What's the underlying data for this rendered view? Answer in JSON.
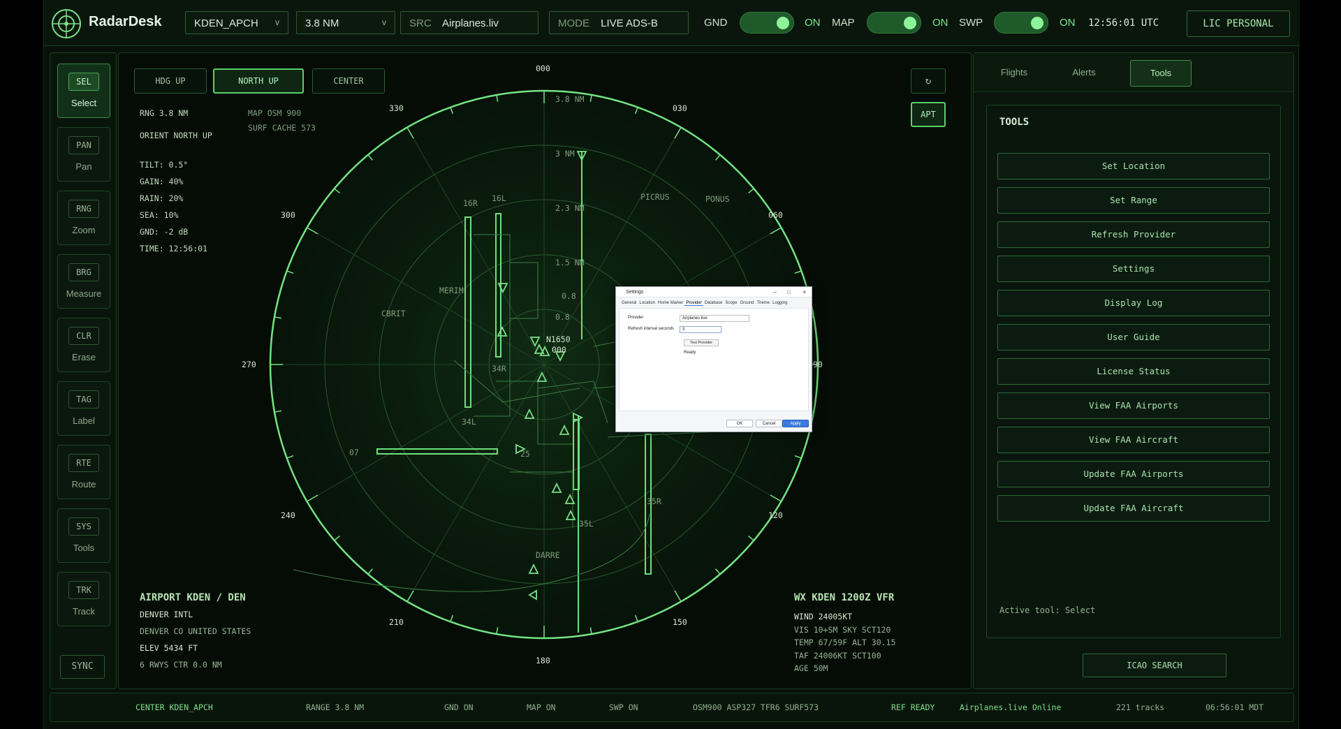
{
  "app": {
    "name": "RadarDesk"
  },
  "topbar": {
    "airport_select": "KDEN_APCH",
    "range_select": "3.8 NM",
    "src_label": "SRC",
    "src_value": "Airplanes.liv",
    "mode_label": "MODE",
    "mode_value": "LIVE ADS-B",
    "toggles": [
      {
        "label": "GND",
        "state": "ON"
      },
      {
        "label": "MAP",
        "state": "ON"
      },
      {
        "label": "SWP",
        "state": "ON"
      }
    ],
    "clock": "12:56:01 UTC",
    "license": "LIC PERSONAL"
  },
  "tools": [
    {
      "code": "SEL",
      "name": "Select",
      "active": true
    },
    {
      "code": "PAN",
      "name": "Pan"
    },
    {
      "code": "RNG",
      "name": "Zoom"
    },
    {
      "code": "BRG",
      "name": "Measure"
    },
    {
      "code": "CLR",
      "name": "Erase"
    },
    {
      "code": "TAG",
      "name": "Label"
    },
    {
      "code": "RTE",
      "name": "Route"
    },
    {
      "code": "SYS",
      "name": "Tools"
    },
    {
      "code": "TRK",
      "name": "Track"
    }
  ],
  "sync_label": "SYNC",
  "radar": {
    "orient_buttons": [
      "HDG UP",
      "NORTH UP",
      "CENTER"
    ],
    "selected_orient": "NORTH UP",
    "refresh_icon": "refresh-icon",
    "apt_button": "APT",
    "rng_text": "RNG  3.8 NM",
    "orient_text": "ORIENT NORTH UP",
    "map_text": "MAP OSM 900",
    "surf_text": "SURF CACHE 573",
    "params": [
      "TILT: 0.5°",
      "GAIN: 40%",
      "RAIN: 20%",
      "SEA: 10%",
      "GND: -2 dB",
      "TIME: 12:56:01"
    ],
    "bearings": [
      "000",
      "030",
      "060",
      "090",
      "120",
      "150",
      "180",
      "210",
      "240",
      "270",
      "300",
      "330"
    ],
    "range_labels": [
      "3.8 NM",
      "3 NM",
      "2.3 NM",
      "1.5 NM",
      "0.8",
      "0.8"
    ],
    "map_labels": [
      "16R",
      "16L",
      "PICRUS",
      "PONUS",
      "MERIM",
      "CBRIT",
      "34R",
      "34L",
      "07",
      "25",
      "35R",
      "35L",
      "DARRE",
      "N1650",
      "000"
    ],
    "airport": {
      "title": "AIRPORT KDEN / DEN",
      "name": "DENVER INTL",
      "location": "DENVER CO UNITED STATES",
      "elev": "ELEV 5434 FT",
      "rwys": "6 RWYS  CTR 0.0 NM"
    },
    "wx": {
      "title": "WX KDEN 1200Z VFR",
      "wind": "WIND 24005KT",
      "vis": "VIS 10+SM  SKY SCT120",
      "temp": "TEMP 67/59F  ALT 30.15",
      "taf": "TAF 24006KT SCT100",
      "age": "AGE 50M"
    }
  },
  "dialog": {
    "title": "Settings",
    "tabs": [
      "General",
      "Location",
      "Home Marker",
      "Provider",
      "Database",
      "Scope",
      "Ground",
      "Theme",
      "Logging"
    ],
    "active_tab": "Provider",
    "provider_label": "Provider",
    "provider_value": "Airplanes.live",
    "refresh_label": "Refresh interval seconds",
    "refresh_value": "3",
    "test_button": "Test Provider",
    "status": "Ready",
    "ok": "OK",
    "cancel": "Cancel",
    "apply": "Apply"
  },
  "rightpanel": {
    "tabs": [
      "Flights",
      "Alerts",
      "Tools"
    ],
    "active_tab": "Tools",
    "heading": "TOOLS",
    "buttons": [
      "Set Location",
      "Set Range",
      "Refresh Provider",
      "Settings",
      "Display Log",
      "User Guide",
      "License Status",
      "View FAA Airports",
      "View FAA Aircraft",
      "Update FAA Airports",
      "Update FAA Aircraft"
    ],
    "active_tool": "Active tool: Select",
    "icao_button": "ICAO SEARCH"
  },
  "statusbar": {
    "center": "CENTER KDEN_APCH",
    "range": "RANGE 3.8 NM",
    "gnd": "GND ON",
    "map": "MAP ON",
    "swp": "SWP ON",
    "layers": "OSM900 ASP327 TFR6 SURF573",
    "ref": "REF READY",
    "provider": "Airplanes.live Online",
    "tracks": "221 tracks",
    "local_time": "06:56:01 MDT"
  },
  "colors": {
    "accent": "#5ad06a",
    "background": "#081109",
    "scope": "#6fe07c"
  }
}
